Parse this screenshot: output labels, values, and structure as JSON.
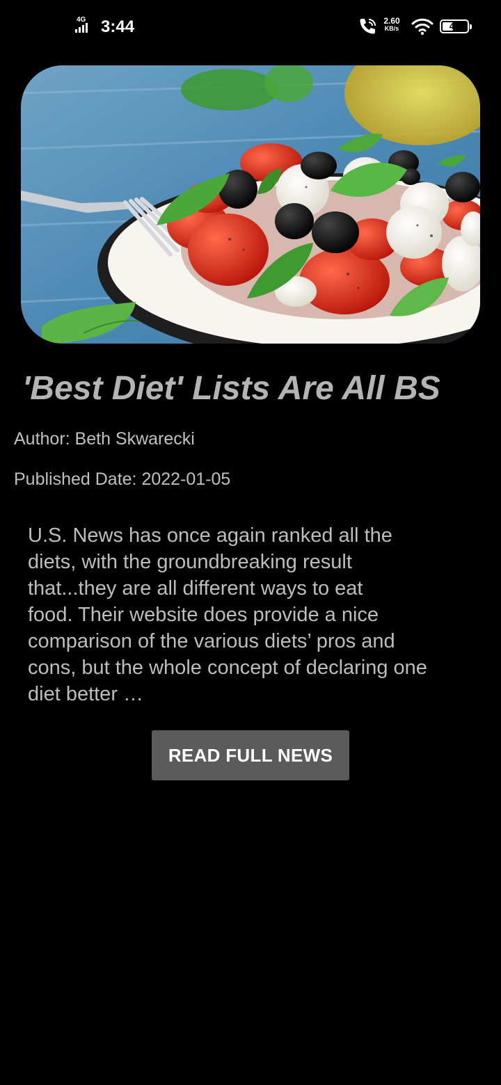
{
  "status_bar": {
    "network_type": "4G",
    "time": "3:44",
    "speed_value": "2.60",
    "speed_unit": "KB/s",
    "battery_percent": "43",
    "battery_level": 0.43,
    "icons": [
      "signal-icon",
      "call-wifi-icon",
      "wifi-icon",
      "battery-icon"
    ]
  },
  "article": {
    "image": "salad-photo",
    "title": "'Best Diet' Lists Are All BS",
    "author": "Author: Beth Skwarecki",
    "published": "Published Date: 2022-01-05",
    "summary": "U.S. News has once again ranked all the\ndiets, with the groundbreaking result\nthat...they are all different ways to eat\nfood. Their website does provide a nice\ncomparison of the various diets’ pros and\ncons, but the whole concept of declaring one\ndiet better …",
    "read_button": "READ FULL NEWS"
  },
  "colors": {
    "background": "#000000",
    "title": "#b4b4b4",
    "meta_text": "#c0c0c0",
    "button_bg": "#5b5b5b",
    "button_text": "#ffffff"
  }
}
